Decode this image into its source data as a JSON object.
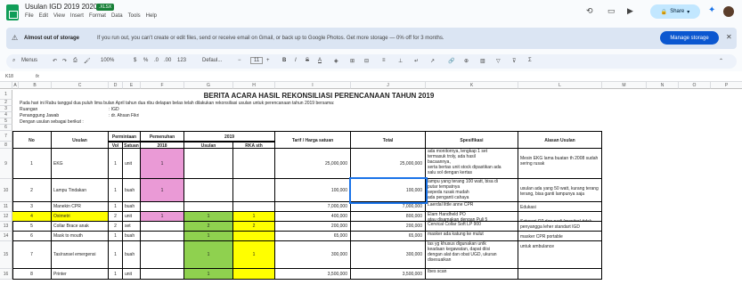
{
  "app": {
    "title": "Usulan IGD 2019 2020",
    "badge": ".XLSX",
    "menus": [
      "File",
      "Edit",
      "View",
      "Insert",
      "Format",
      "Data",
      "Tools",
      "Help"
    ],
    "share_label": "Share"
  },
  "banner": {
    "title": "Almost out of storage",
    "text": "If you run out, you can't create or edit files, send or receive email on Gmail, or back up to Google Photos. Get more storage — 0% off for 3 months.",
    "button": "Manage storage"
  },
  "toolbar": {
    "menus_label": "Menus",
    "zoom": "100%",
    "format_pct": "%",
    "dec1": ".0",
    "dec2": ".00",
    "num": "123",
    "font": "Defaul...",
    "font_size": "11"
  },
  "formula_bar": {
    "cell_ref": "K18"
  },
  "columns": [
    "A",
    "B",
    "C",
    "D",
    "E",
    "F",
    "G",
    "H",
    "I",
    "J",
    "K",
    "L",
    "M",
    "N",
    "O",
    "P"
  ],
  "sheet": {
    "title": "BERITA ACARA HASIL REKONSILIASI PERENCANAAN TAHUN 2019",
    "intro": "Pada hari ini Rabu tanggal dua puluh lima bulan April tahun dua ribu delapan belas telah dilakukan rekonsiliasi usulan untuk perencanaan tahun 2019 bersama:",
    "ruangan_label": "Ruangan",
    "ruangan_value": ": IGD",
    "pj_label": "Penanggung Jawab",
    "pj_value": ": dr. Ahsan Fikri",
    "usulan_label": "Dengan usulan sebagai berikut :",
    "headers": {
      "no": "No",
      "usulan": "Usulan",
      "permintaan": "Permintaan",
      "vol": "Vol",
      "satuan": "Satuan",
      "pemenuhan": "Pemenuhan",
      "y2018": "2018",
      "y2019": "2019",
      "usulan2": "Usulan",
      "rka": "RKA sth",
      "tarif": "Tarif / Harga satuan",
      "total": "Total",
      "spesifikasi": "Spesifikasi",
      "alasan": "Alasan Usulan"
    },
    "rows": [
      {
        "rownum": "9",
        "no": "1",
        "item": "EKG",
        "vol": "1",
        "satuan": "unit",
        "p2018": "1",
        "usulan": "",
        "rka": "",
        "tarif": "25,000,000",
        "total": "25,000,000",
        "spek": [
          "ada monitornya, lengkap 1 set",
          "termasuk troly, ada hasil",
          "bacaannya,",
          "serta bertas unit stock dipastikan ada",
          "salu sol dengan kertas"
        ],
        "alasan": [
          "Mesin EKG lama buatan th 2008 sudah",
          "sering rusak"
        ]
      },
      {
        "rownum": "10",
        "no": "2",
        "item": "Lampu Tindakan",
        "vol": "1",
        "satuan": "buah",
        "p2018": "1",
        "usulan": "",
        "rka": "",
        "tarif": "100,000",
        "total": "100,000",
        "spek": [
          "lampu yang terang 100 watt, bisa di",
          "putar tempatnya",
          "sepeda rusak mudah",
          "ada penganti cahaya"
        ],
        "alasan": [
          "usulan ada yang 50 watt, kurang terang",
          "terang, bisa ganti lampunya saja"
        ]
      },
      {
        "rownum": "11",
        "no": "3",
        "item": "Manekin CPR",
        "vol": "1",
        "satuan": "buah",
        "p2018": "",
        "usulan": "",
        "rka": "",
        "tarif": "7,000,000",
        "total": "7,000,000",
        "spek": [
          "Laerdal little anne CPR"
        ],
        "alasan": [
          "Edukasi"
        ]
      },
      {
        "rownum": "12",
        "no": "4",
        "item": "Oximetri",
        "vol": "2",
        "satuan": "unit",
        "p2018": "1",
        "usulan": "1",
        "rka": "1",
        "tarif": "400,000",
        "total": "800,000",
        "spek": [
          "Elam Handheld PO",
          "atau disamakan dengan Puli 5"
        ],
        "alasan": [
          "Saturasi O2 dan nadi (monitor) tidak dengan",
          "monitor. Bisa cik dengan alat ends"
        ]
      },
      {
        "rownum": "13",
        "no": "5",
        "item": "Collar Brace anak",
        "vol": "2",
        "satuan": "set",
        "p2018": "",
        "usulan": "2",
        "rka": "2",
        "tarif": "200,000",
        "total": "200,000",
        "spek": [
          "Cervical Collar Soft LP 900"
        ],
        "alasan": [
          "penyangga leher standart IGD"
        ]
      },
      {
        "rownum": "14",
        "no": "6",
        "item": "Mask to mouth",
        "vol": "1",
        "satuan": "buah",
        "p2018": "",
        "usulan": "1",
        "rka": "",
        "tarif": "65,000",
        "total": "65,000",
        "spek": [
          "masker ada katung ke mulut"
        ],
        "alasan": [
          "masker CPR portable"
        ]
      },
      {
        "rownum": "15",
        "no": "7",
        "item": "Tas/ransel emergensi",
        "vol": "1",
        "satuan": "buah",
        "p2018": "",
        "usulan": "1",
        "rka": "1",
        "tarif": "300,000",
        "total": "300,000",
        "spek": [
          "tas yg khusus digunakan untk",
          "keadaan kegawatan, dapat diisi",
          "dengan alat dan obat UGD, ukuran",
          "disesuaikan"
        ],
        "alasan": [
          "untuk ambulance"
        ]
      },
      {
        "rownum": "16",
        "no": "8",
        "item": "Printer",
        "vol": "1",
        "satuan": "unit",
        "p2018": "",
        "usulan": "1",
        "rka": "",
        "tarif": "3,500,000",
        "total": "3,500,000",
        "spek": [
          "Ibes scan"
        ],
        "alasan": [
          ""
        ]
      }
    ]
  },
  "colors": {
    "pink": "#ea9ad6",
    "yellow": "#ffff00",
    "green": "#8fd14f",
    "accent": "#0b57d0"
  }
}
